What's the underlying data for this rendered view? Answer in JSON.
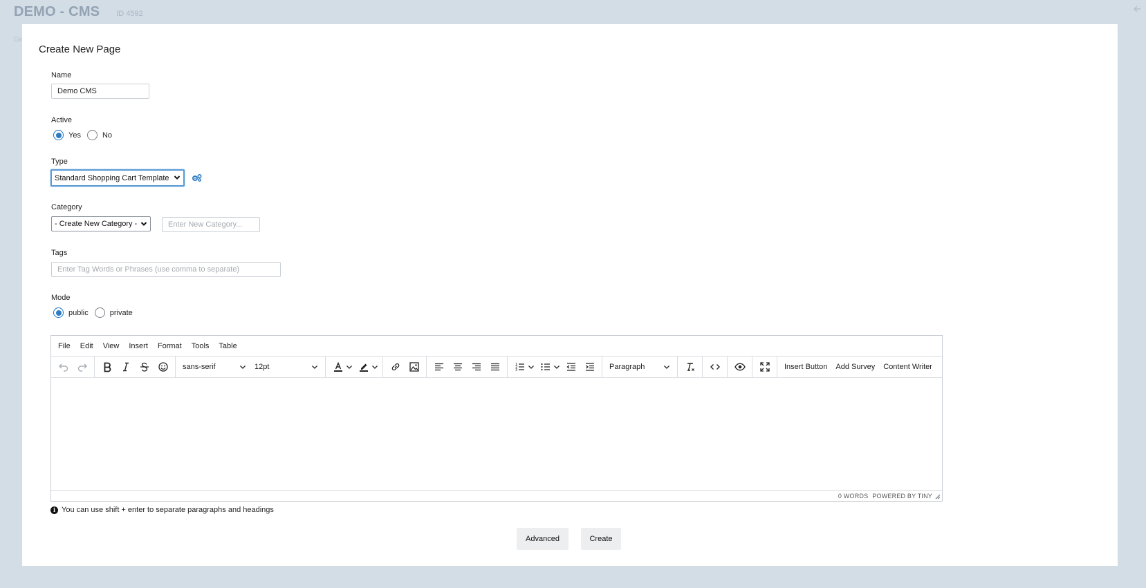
{
  "background": {
    "app_title": "DEMO - CMS",
    "app_id": "ID 4592",
    "crumb": "Ge"
  },
  "modal": {
    "title": "Create New Page",
    "name": {
      "label": "Name",
      "value": "Demo CMS"
    },
    "active": {
      "label": "Active",
      "options": [
        "Yes",
        "No"
      ],
      "selected": "Yes"
    },
    "type": {
      "label": "Type",
      "selected": "Standard Shopping Cart Template"
    },
    "category": {
      "label": "Category",
      "selected": "- Create New Category -",
      "new_placeholder": "Enter New Category..."
    },
    "tags": {
      "label": "Tags",
      "placeholder": "Enter Tag Words or Phrases (use comma to separate)"
    },
    "mode": {
      "label": "Mode",
      "options": [
        "public",
        "private"
      ],
      "selected": "public"
    },
    "editor": {
      "menu": [
        "File",
        "Edit",
        "View",
        "Insert",
        "Format",
        "Tools",
        "Table"
      ],
      "font_family": "sans-serif",
      "font_size": "12pt",
      "block_format": "Paragraph",
      "custom_buttons": [
        "Insert Button",
        "Add Survey",
        "Content Writer"
      ],
      "word_count": "0 WORDS",
      "powered_by": "POWERED BY TINY"
    },
    "hint": "You can use shift + enter to separate paragraphs and headings",
    "buttons": {
      "advanced": "Advanced",
      "create": "Create"
    }
  },
  "colors": {
    "accent": "#2d7cc3",
    "backdrop": "#d2dde6",
    "button_bg": "#eceef0"
  }
}
